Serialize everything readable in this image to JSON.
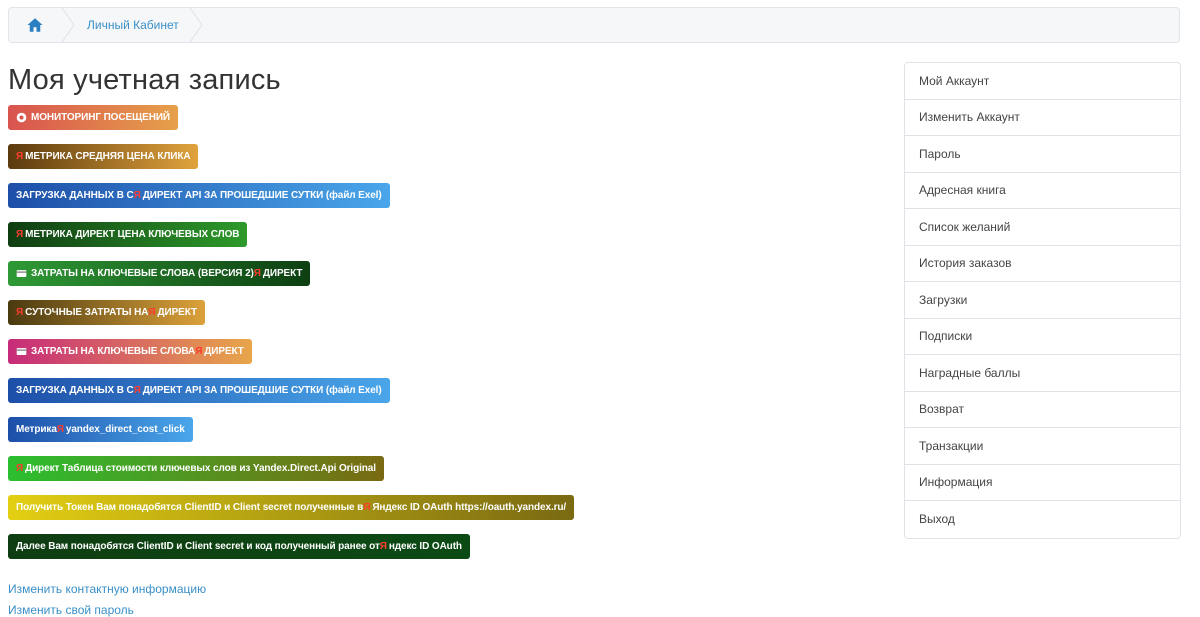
{
  "breadcrumb": {
    "home_icon": "home-icon",
    "items": [
      {
        "label": "Личный Кабинет"
      }
    ]
  },
  "page": {
    "title": "Моя учетная запись"
  },
  "colors": {
    "link": "#3a8fc7",
    "yandex_red": "#ff3b2f",
    "brand_blue": "#1e5fb0"
  },
  "buttons": [
    {
      "icon": "eye-icon",
      "text": "МОНИТОРИНГ ПОСЕЩЕНИЙ",
      "bg": "linear-gradient(90deg,#d9534f,#e6a04a)"
    },
    {
      "prefix": "Я",
      "text": "МЕТРИКА СРЕДНЯЯ ЦЕНА КЛИКА",
      "bg": "linear-gradient(90deg,#5b3a0e,#e0a23c)"
    },
    {
      "pre": "ЗАГРУЗКА ДАННЫХ В С ",
      "ya": "Я",
      "post": "ДИРЕКТ API ЗА ПРОШЕДШИЕ СУТКИ (файл Exel)",
      "bg": "linear-gradient(90deg,#1d4fa8,#4aa6ea)"
    },
    {
      "prefix": "Я",
      "text": "МЕТРИКА ДИРЕКТ ЦЕНА КЛЮЧЕВЫХ СЛОВ",
      "bg": "linear-gradient(90deg,#0f3d12,#2e9a2a)"
    },
    {
      "icon": "money-icon",
      "pre": "ЗАТРАТЫ НА КЛЮЧЕВЫЕ СЛОВА (ВЕРСИЯ 2) ",
      "ya": "Я",
      "post": "ДИРЕКТ",
      "bg": "linear-gradient(90deg,#2f9a35,#0d3f12)"
    },
    {
      "prefix": "Я",
      "pre": "СУТОЧНЫЕ ЗАТРАТЫ НА ",
      "ya": "Я",
      "post": "ДИРЕКТ",
      "bg": "linear-gradient(90deg,#4a3a10,#dca13a)"
    },
    {
      "icon": "money-icon",
      "pre": "ЗАТРАТЫ НА КЛЮЧЕВЫЕ СЛОВА ",
      "ya": "Я",
      "post": "ДИРЕКТ",
      "bg": "linear-gradient(90deg,#c72b7a,#e8a64a)"
    },
    {
      "pre": "ЗАГРУЗКА ДАННЫХ В С ",
      "ya": "Я",
      "post": "ДИРЕКТ API ЗА ПРОШЕДШИЕ СУТКИ (файл Exel)",
      "bg": "linear-gradient(90deg,#1d4fa8,#4aa6ea)"
    },
    {
      "pre": "Метрика ",
      "ya": "Я",
      "post": "yandex_direct_cost_click",
      "bg": "linear-gradient(90deg,#1d4fa8,#4aa6ea)"
    },
    {
      "prefix": "Я",
      "text": "Директ Таблица стоимости ключевых слов из Yandex.Direct.Api Original",
      "bg": "linear-gradient(90deg,#2bbf2f,#7a6a12)"
    },
    {
      "pre": "Получить Токен Вам понадобятся ClientID и Client secret полученные в ",
      "ya": "Я",
      "post": "Яндекс ID OAuth https://oauth.yandex.ru/",
      "bg": "linear-gradient(90deg,#e3cf12,#7a6a12)"
    },
    {
      "pre": "Далее Вам понадобятся ClientID и Client secret и код полученный ранее от ",
      "ya": "Я",
      "post": "ндекс ID OAuth",
      "bg": "linear-gradient(90deg,#0f3d12,#0c4a14)"
    }
  ],
  "links": [
    {
      "text": "Изменить контактную информацию"
    },
    {
      "text": "Изменить свой пароль"
    }
  ],
  "sidebar": {
    "items": [
      {
        "label": "Мой Аккаунт"
      },
      {
        "label": "Изменить Аккаунт"
      },
      {
        "label": "Пароль"
      },
      {
        "label": "Адресная книга"
      },
      {
        "label": "Список желаний"
      },
      {
        "label": "История заказов"
      },
      {
        "label": "Загрузки"
      },
      {
        "label": "Подписки"
      },
      {
        "label": "Наградные баллы"
      },
      {
        "label": "Возврат"
      },
      {
        "label": "Транзакции"
      },
      {
        "label": "Информация"
      },
      {
        "label": "Выход"
      }
    ]
  }
}
